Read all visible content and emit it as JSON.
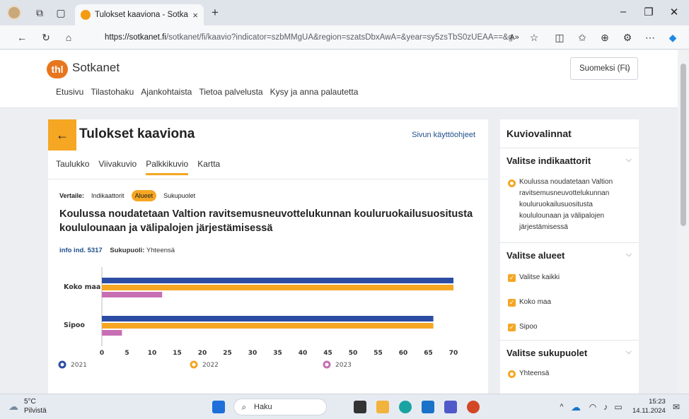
{
  "browser": {
    "tab_title": "Tulokset kaaviona - Sotkanet.fi, T",
    "tab_close": "×",
    "new_tab": "+",
    "url_host": "https://sotkanet.fi",
    "url_path": "/sotkanet/fi/kaavio?indicator=szbMMgUA&region=szatsDbxAwA=&year=sy5zsTbS0zUEAA==&g..."
  },
  "site": {
    "brand_logo": "thl",
    "brand_name": "Sotkanet",
    "language": "Suomeksi (FI)",
    "nav": [
      "Etusivu",
      "Tilastohaku",
      "Ajankohtaista",
      "Tietoa palvelusta",
      "Kysy ja anna palautetta"
    ]
  },
  "main": {
    "back": "←",
    "title": "Tulokset kaaviona",
    "help_link": "Sivun käyttöohjeet",
    "tabs": [
      "Taulukko",
      "Viivakuvio",
      "Palkkikuvio",
      "Kartta"
    ],
    "active_tab": 2,
    "compare_label": "Vertaile:",
    "compare_options": [
      "Indikaattorit",
      "Alueet",
      "Sukupuolet"
    ],
    "compare_active": 1,
    "chart_title": "Koulussa noudatetaan Valtion ravitsemusneuvottelukunnan kouluruokailusuositusta koululounaan ja välipalojen järjestämisessä",
    "info_ind": "info ind. 5317",
    "gender_label": "Sukupuoli:",
    "gender_value": "Yhteensä"
  },
  "chart_data": {
    "type": "bar",
    "orientation": "horizontal",
    "categories": [
      "Koko maa",
      "Sipoo"
    ],
    "series": [
      {
        "name": "2021",
        "values": [
          70,
          66
        ],
        "color": "#2c4da3"
      },
      {
        "name": "2022",
        "values": [
          70,
          66
        ],
        "color": "#f5a623"
      },
      {
        "name": "2023",
        "values": [
          12,
          4
        ],
        "color": "#c86fb4"
      }
    ],
    "xlim": [
      0,
      70
    ],
    "xticks": [
      0,
      5,
      10,
      15,
      20,
      25,
      30,
      35,
      40,
      45,
      50,
      55,
      60,
      65,
      70
    ],
    "legend_position": "bottom"
  },
  "side": {
    "title": "Kuviovalinnat",
    "indicators_head": "Valitse indikaattorit",
    "indicator_lines": [
      "Koulussa noudatetaan Valtion",
      "ravitsemusneuvottelukunnan",
      "kouluruokailusuositusta",
      "koululounaan ja välipalojen",
      "järjestämisessä"
    ],
    "regions_head": "Valitse alueet",
    "regions": [
      "Valitse kaikki",
      "Koko maa",
      "Sipoo"
    ],
    "genders_head": "Valitse sukupuolet",
    "genders": [
      "Yhteensä"
    ]
  },
  "taskbar": {
    "temp": "5°C",
    "weather": "Pilvistä",
    "search": "Haku",
    "time": "15:23",
    "date": "14.11.2024"
  }
}
